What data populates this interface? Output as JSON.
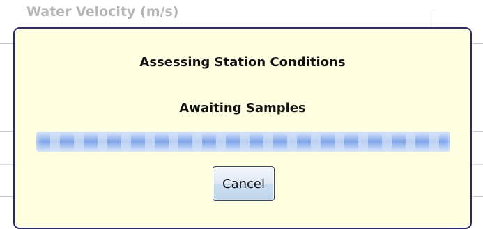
{
  "background": {
    "field_label": "Water Velocity (m/s)"
  },
  "dialog": {
    "title": "Assessing Station Conditions",
    "status": "Awaiting Samples",
    "progress_fraction": 1.0,
    "progress_mode": "indeterminate-striped",
    "cancel_label": "Cancel"
  },
  "colors": {
    "dialog_background": "#ffffe1",
    "dialog_border": "#2b2b6b",
    "progress_stripe": "#7ea4ea",
    "progress_glow": "#bcd0f4"
  }
}
